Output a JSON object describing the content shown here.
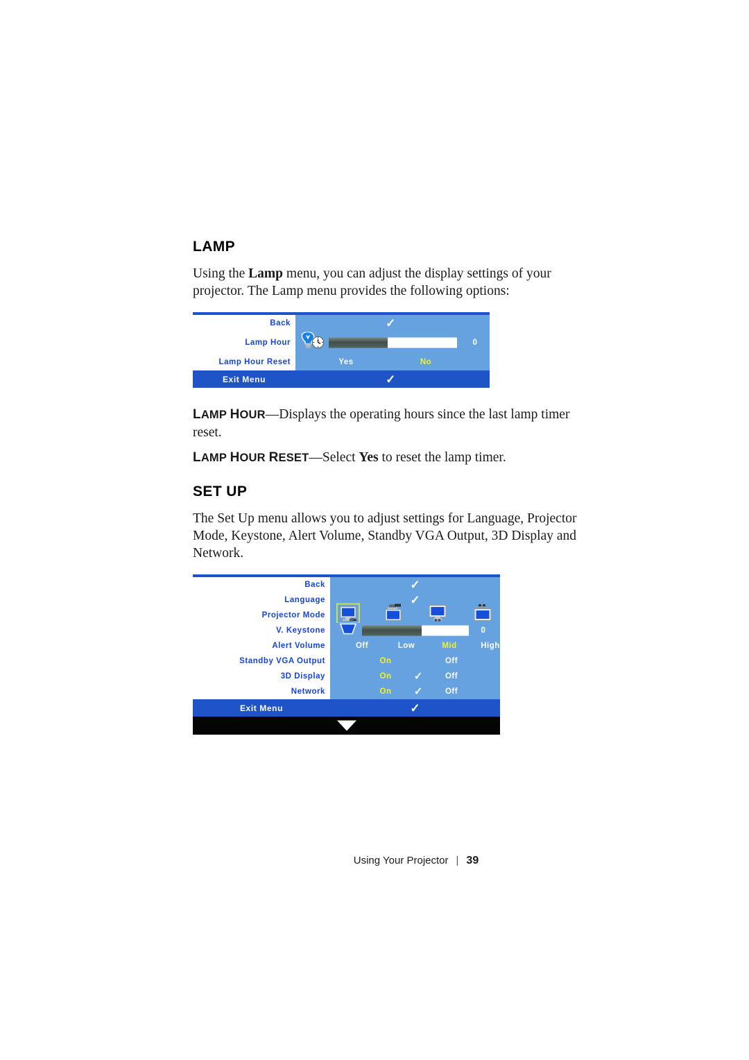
{
  "sections": {
    "lamp": {
      "heading": "LAMP",
      "intro_a": "Using the ",
      "intro_b": "Lamp",
      "intro_c": " menu, you can adjust the display settings of your projector. The Lamp menu provides the following options:",
      "defs": [
        {
          "term_a": "L",
          "term_b": "AMP ",
          "term_c": "H",
          "term_d": "OUR",
          "dash": "—",
          "desc": "Displays the operating hours since the last lamp timer reset."
        },
        {
          "term_a": "L",
          "term_b": "AMP ",
          "term_c": "H",
          "term_d": "OUR ",
          "term_e": "R",
          "term_f": "ESET",
          "dash": "—",
          "desc_pre": "Select ",
          "desc_bold": "Yes",
          "desc_post": " to reset the lamp timer."
        }
      ]
    },
    "setup": {
      "heading": "SET UP",
      "intro": "The Set Up menu allows you to adjust settings for Language, Projector Mode, Keystone, Alert Volume, Standby VGA Output, 3D Display and Network."
    }
  },
  "lamp_menu": {
    "rows": [
      {
        "label": "Back",
        "type": "check"
      },
      {
        "label": "Lamp Hour",
        "type": "slider",
        "icon": "lamp-clock-icon",
        "value": "0"
      },
      {
        "label": "Lamp Hour Reset",
        "type": "options",
        "options": [
          {
            "text": "Yes",
            "highlighted": false
          },
          {
            "text": "No",
            "highlighted": true
          }
        ]
      }
    ],
    "exit_label": "Exit Menu"
  },
  "setup_menu": {
    "rows": [
      {
        "label": "Back",
        "type": "check"
      },
      {
        "label": "Language",
        "type": "check"
      },
      {
        "label": "Projector Mode",
        "type": "icons",
        "icons": [
          {
            "name": "projector-front-desktop-icon",
            "selected": true
          },
          {
            "name": "projector-rear-desktop-icon",
            "selected": false
          },
          {
            "name": "projector-front-ceiling-icon",
            "selected": false
          },
          {
            "name": "projector-rear-ceiling-icon",
            "selected": false
          }
        ]
      },
      {
        "label": "V. Keystone",
        "type": "slider",
        "icon": "keystone-trapezoid-icon",
        "value": "0"
      },
      {
        "label": "Alert Volume",
        "type": "options4",
        "options": [
          {
            "text": "Off",
            "highlighted": false
          },
          {
            "text": "Low",
            "highlighted": false
          },
          {
            "text": "Mid",
            "highlighted": true
          },
          {
            "text": "High",
            "highlighted": false
          }
        ]
      },
      {
        "label": "Standby VGA Output",
        "type": "onoff",
        "options": [
          {
            "text": "On",
            "highlighted": true
          },
          {
            "text": "Off",
            "highlighted": false
          }
        ],
        "check": false
      },
      {
        "label": "3D Display",
        "type": "onoff",
        "options": [
          {
            "text": "On",
            "highlighted": true
          },
          {
            "text": "Off",
            "highlighted": false
          }
        ],
        "check": true
      },
      {
        "label": "Network",
        "type": "onoff",
        "options": [
          {
            "text": "On",
            "highlighted": true
          },
          {
            "text": "Off",
            "highlighted": false
          }
        ],
        "check": true
      }
    ],
    "exit_label": "Exit Menu"
  },
  "footer": {
    "chapter": "Using Your Projector",
    "separator": "|",
    "page": "39"
  },
  "colors": {
    "menu_label_text": "#1545d6",
    "menu_panel": "#67a2e0",
    "menu_bar": "#1f54c9",
    "highlight_yellow": "#f2f224",
    "selection_border": "#c8e04a"
  }
}
